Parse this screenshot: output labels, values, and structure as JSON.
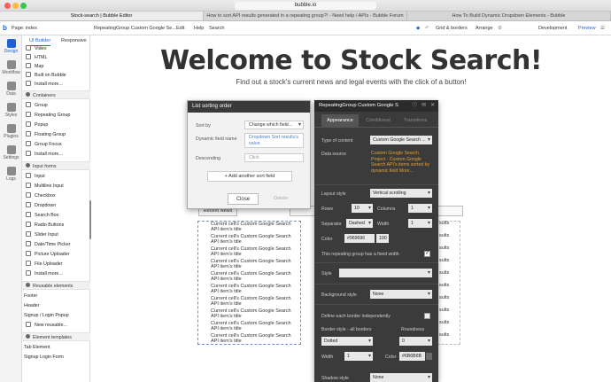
{
  "browser": {
    "url": "bubble.io",
    "tabs": [
      "Stock-search | Bubble Editor",
      "How to sort API results generated in a repeating group?! - Need help / APIs - Bubble Forum",
      "How To Build Dynamic Dropdown Elements - Bubble"
    ]
  },
  "topbar": {
    "page_label": "Page: index",
    "element_selector": "RepeatingGroup Custom Google Se...",
    "edit": "Edit",
    "help": "Help",
    "search": "Search",
    "grid_borders": "Grid & borders",
    "arrange": "Arrange",
    "version": "Development",
    "preview": "Preview"
  },
  "rail": {
    "items": [
      "Design",
      "Workflow",
      "Data",
      "Styles",
      "Plugins",
      "Settings",
      "Logs"
    ]
  },
  "palette": {
    "tab_ui": "UI Builder",
    "tab_responsive": "Responsive",
    "items": [
      "Video",
      "HTML",
      "Map",
      "Built on Bubble",
      "Install more..."
    ],
    "section_containers": "Containers",
    "containers": [
      "Group",
      "Repeating Group",
      "Popup",
      "Floating Group",
      "Group Focus",
      "Install more..."
    ],
    "section_input": "Input forms",
    "inputs": [
      "Input",
      "Multiline Input",
      "Checkbox",
      "Dropdown",
      "Search Box",
      "Radio Buttons",
      "Slider Input",
      "Date/Time Picker",
      "Picture Uploader",
      "File Uploader",
      "Install more..."
    ],
    "section_reusable": "Reusable elements",
    "reusables": [
      "Footer",
      "Header",
      "Signup / Login Popup",
      "New reusable..."
    ],
    "section_templates": "Element templates",
    "templates": [
      "Tab Element",
      "Signup Login Form"
    ]
  },
  "canvas": {
    "title": "Welcome to Stock Search!",
    "subtitle": "Find out a stock's current news and legal events with the click of a button!",
    "recent_news": "Recent News",
    "cell_text": "Current cell's Custom Google Search API item's title",
    "right_cell_text": "sults"
  },
  "sort_panel": {
    "title": "List sorting order",
    "sort_by_label": "Sort by",
    "sort_by_value": "Change which field...",
    "dynamic_label": "Dynamic field name",
    "dynamic_value": "Dropdown Sort results's value",
    "descending_label": "Descending",
    "descending_value": "Click",
    "add_sort": "Add another sort field",
    "close": "Close",
    "delete": "Delete"
  },
  "prop_panel": {
    "title": "RepeatingGroup Custom Google S",
    "tabs": [
      "Appearance",
      "Conditional",
      "Transitions"
    ],
    "type_label": "Type of content",
    "type_value": "Custom Google Search ...",
    "source_label": "Data source",
    "source_value": "Custom Google Search Project - Custom Google Search API's items sorted by dynamic field More...",
    "layout_label": "Layout style",
    "layout_value": "Vertical scrolling",
    "rows_label": "Rows",
    "rows_value": "10",
    "columns_label": "Columns",
    "columns_value": "1",
    "separator_label": "Separator",
    "separator_value": "Dashed",
    "width_label": "Width",
    "width_value": "1",
    "color_label": "Color",
    "color_value": "#969696",
    "color_opacity": "100",
    "fixed_label": "This repeating group has a fixed width",
    "style_label": "Style",
    "bg_label": "Background style",
    "bg_value": "None",
    "border_indep_label": "Define each border independently",
    "border_style_label": "Border style - all borders",
    "roundness_label": "Roundness",
    "border_value": "Dotted",
    "roundness_value": "0",
    "bwidth_label": "Width",
    "bwidth_value": "1",
    "bcolor_label": "Color",
    "bcolor_value": "#6B6B6B",
    "shadow_label": "Shadow style",
    "shadow_value": "None"
  },
  "colors": {
    "accent": "#1e63d6",
    "panel_dark": "#3b3b3b",
    "link_orange": "#e3a12f"
  }
}
